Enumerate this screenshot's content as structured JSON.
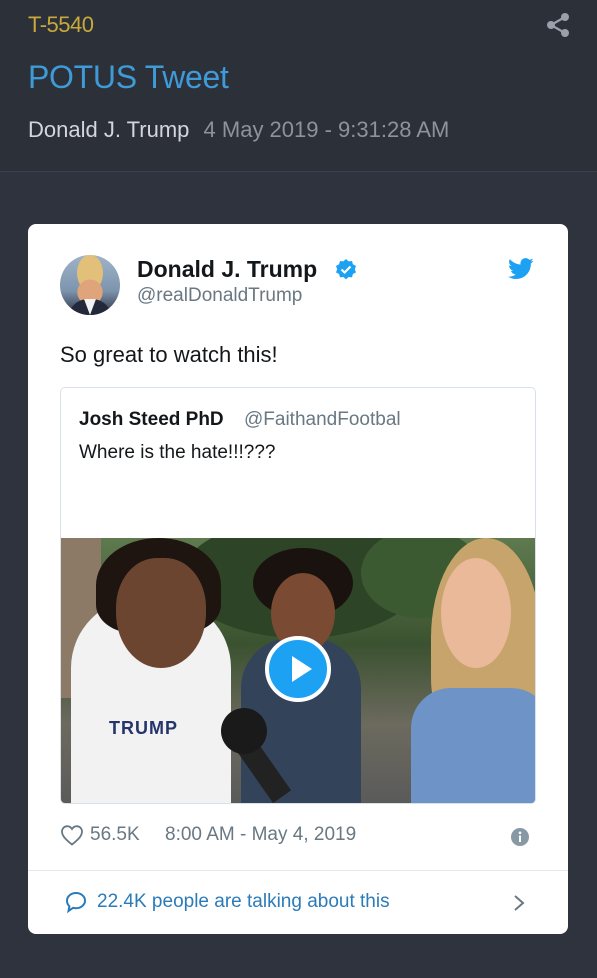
{
  "header": {
    "post_id": "T-5540",
    "title": "POTUS Tweet",
    "author": "Donald J. Trump",
    "date": "4 May 2019 - 9:31:28 AM"
  },
  "tweet": {
    "name": "Donald J. Trump",
    "handle": "@realDonaldTrump",
    "text": "So great to watch this!",
    "likes": "56.5K",
    "timestamp": "8:00 AM - May 4, 2019",
    "talking": "22.4K people are talking about this"
  },
  "quoted_tweet": {
    "name": "Josh Steed PhD",
    "handle": "@FaithandFootbal",
    "text": "Where is the hate!!!???",
    "video_shirt_text": "TRUMP"
  },
  "colors": {
    "background": "#2f333d",
    "post_id": "#c9a93a",
    "title": "#3f9ad8",
    "twitter_blue": "#1da1f2",
    "link_blue": "#2b7bb9"
  }
}
